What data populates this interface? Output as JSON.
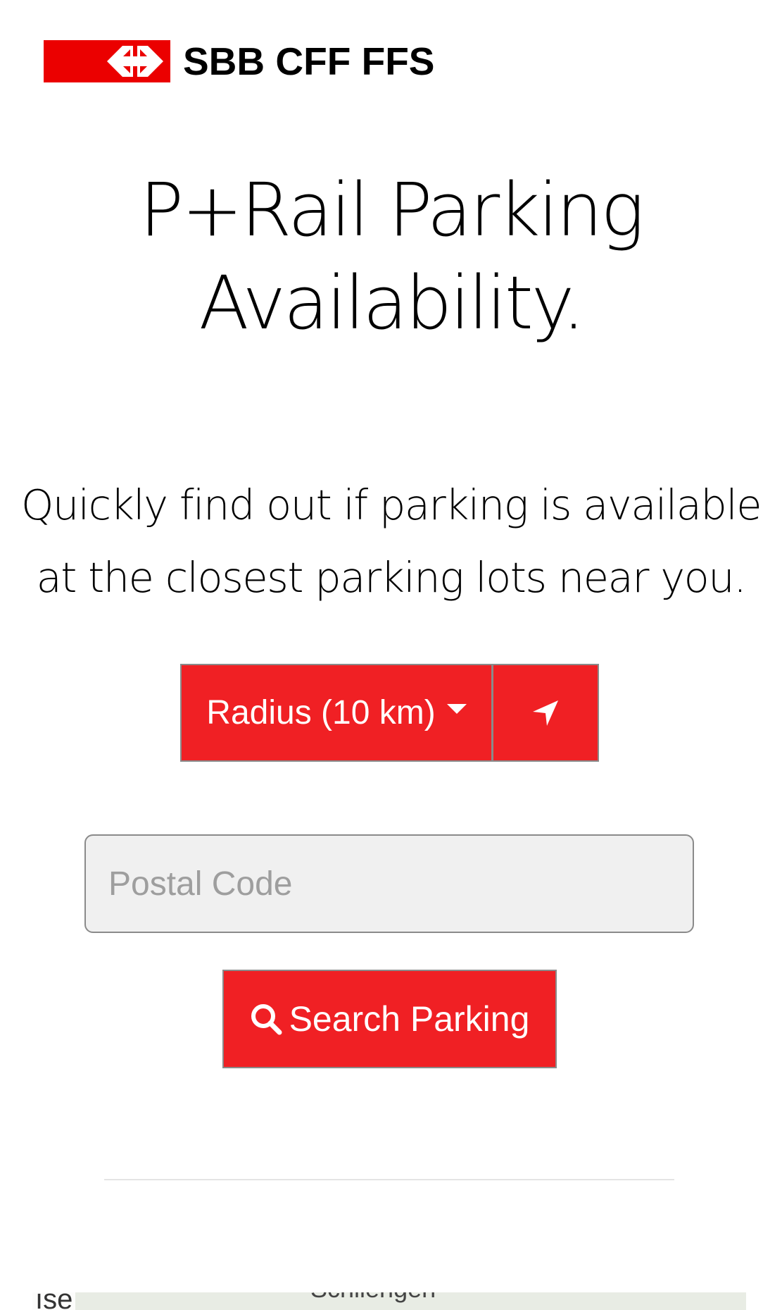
{
  "brand": {
    "name": "SBB CFF FFS",
    "flag_color": "#eb0000",
    "logo_icon": "swiss-rail-arrows-icon"
  },
  "hero": {
    "title_line1": "P+Rail Parking",
    "title_line2": "Availability.",
    "subtitle_line1": "Quickly find out if parking is available",
    "subtitle_line2": "at the closest parking lots near you."
  },
  "controls": {
    "radius_label": "Radius (10 km)",
    "radius_icon": "caret-down-icon",
    "locate_icon": "location-arrow-icon",
    "postal_placeholder": "Postal Code",
    "postal_value": "",
    "search_label": "Search Parking",
    "search_icon": "search-icon",
    "accent_color": "#f02024"
  },
  "map": {
    "label_left": "ıse",
    "label_mid": "Schliengen"
  }
}
